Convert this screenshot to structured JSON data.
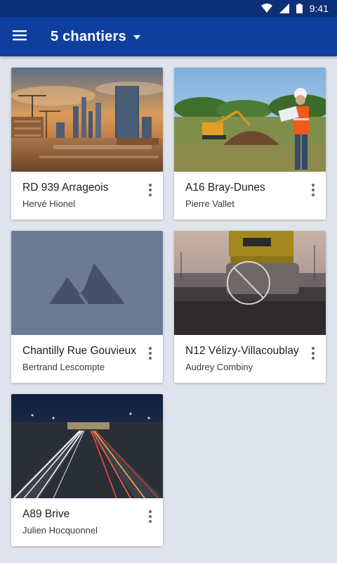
{
  "status_bar": {
    "time": "9:41",
    "icons": [
      "wifi-icon",
      "signal-icon",
      "battery-icon"
    ]
  },
  "app_bar": {
    "title": "5 chantiers",
    "menu_icon": "menu-icon",
    "dropdown_icon": "caret-down-icon"
  },
  "colors": {
    "primary": "#0f3f9e",
    "primary_dark": "#0c2f78",
    "background": "#dfe3ec",
    "placeholder": "#6c7a95"
  },
  "projects": [
    {
      "title": "RD 939 Arrageois",
      "manager": "Hervé Hionel",
      "image": "city-construction-photo"
    },
    {
      "title": "A16 Bray-Dunes",
      "manager": "Pierre Vallet",
      "image": "excavator-worker-photo"
    },
    {
      "title": "Chantilly Rue Gouvieux",
      "manager": "Bertrand Lescompte",
      "image": "placeholder-mountain-icon"
    },
    {
      "title": "N12 Vélizy-Villacoublay",
      "manager": "Audrey Combiny",
      "image": "road-roller-photo",
      "overlay_icon": "blocked-icon"
    },
    {
      "title": "A89 Brive",
      "manager": "Julien Hocquonnel",
      "image": "highway-night-photo"
    }
  ]
}
